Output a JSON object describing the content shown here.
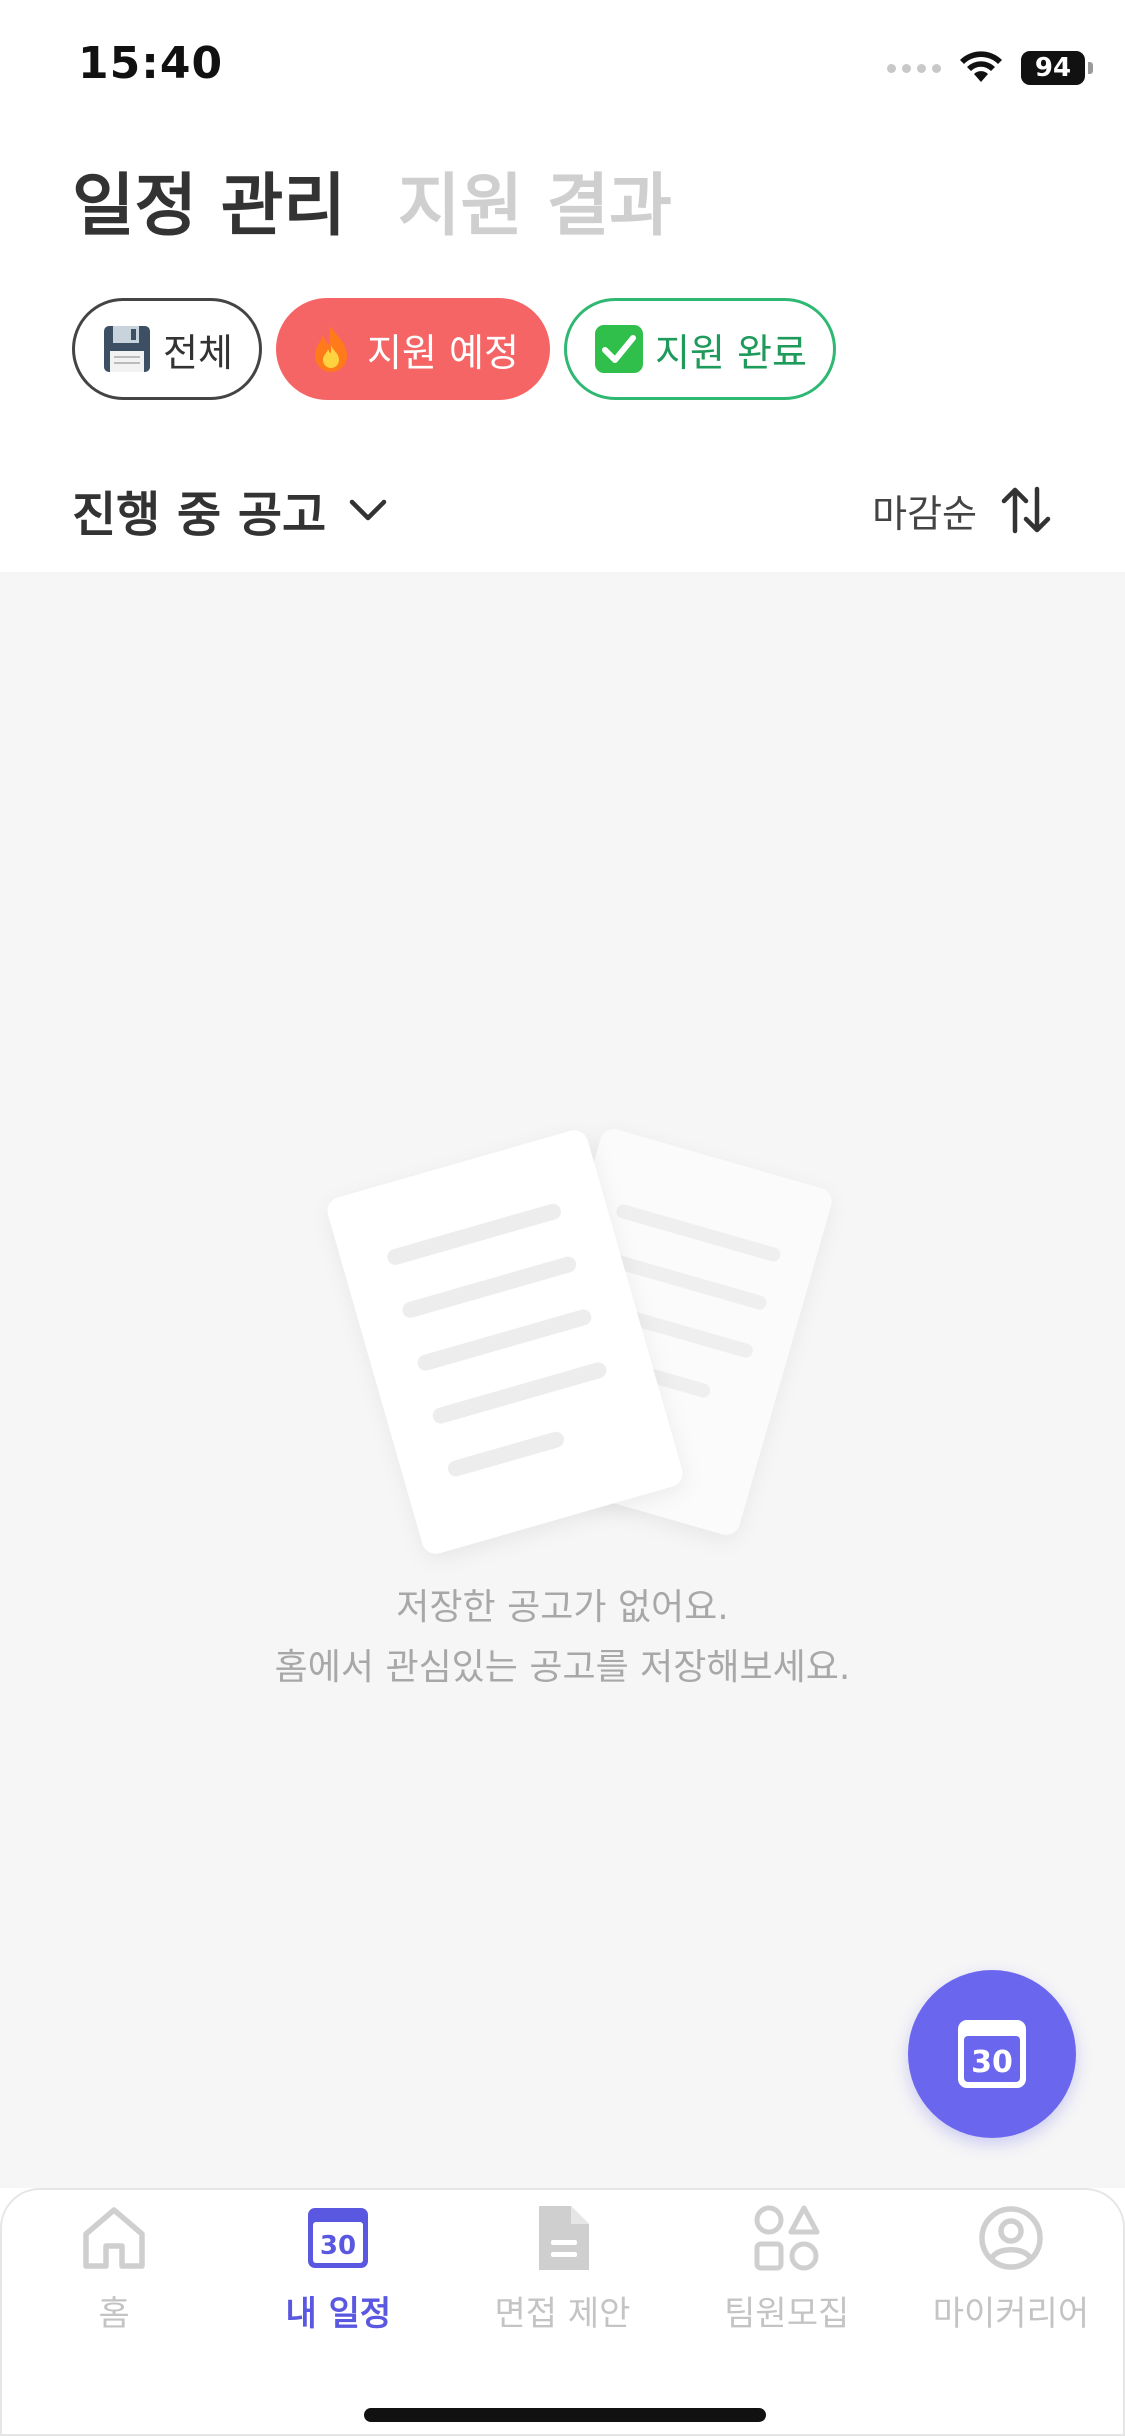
{
  "status_bar": {
    "time": "15:40",
    "battery": "94"
  },
  "header": {
    "tabs": [
      {
        "label": "일정 관리",
        "active": true
      },
      {
        "label": "지원 결과",
        "active": false
      }
    ]
  },
  "filters": {
    "all": {
      "label": "전체",
      "icon": "floppy-disk-icon"
    },
    "planned": {
      "label": "지원 예정",
      "icon": "fire-icon"
    },
    "done": {
      "label": "지원 완료",
      "icon": "check-mark-icon"
    }
  },
  "section": {
    "title": "진행 중 공고",
    "sort_label": "마감순"
  },
  "empty_state": {
    "line1": "저장한 공고가 없어요.",
    "line2": "홈에서 관심있는 공고를 저장해보세요."
  },
  "fab": {
    "icon": "calendar-icon",
    "day": "30"
  },
  "bottom_nav": {
    "items": [
      {
        "label": "홈",
        "icon": "home-icon"
      },
      {
        "label": "내 일정",
        "icon": "calendar-icon",
        "day": "30",
        "active": true
      },
      {
        "label": "면접 제안",
        "icon": "document-icon"
      },
      {
        "label": "팀원모집",
        "icon": "shapes-icon"
      },
      {
        "label": "마이커리어",
        "icon": "profile-icon"
      }
    ]
  },
  "colors": {
    "accent": "#6a67ee",
    "planned_chip": "#f56565",
    "done_chip": "#2eb872",
    "background": "#f6f6f6"
  }
}
